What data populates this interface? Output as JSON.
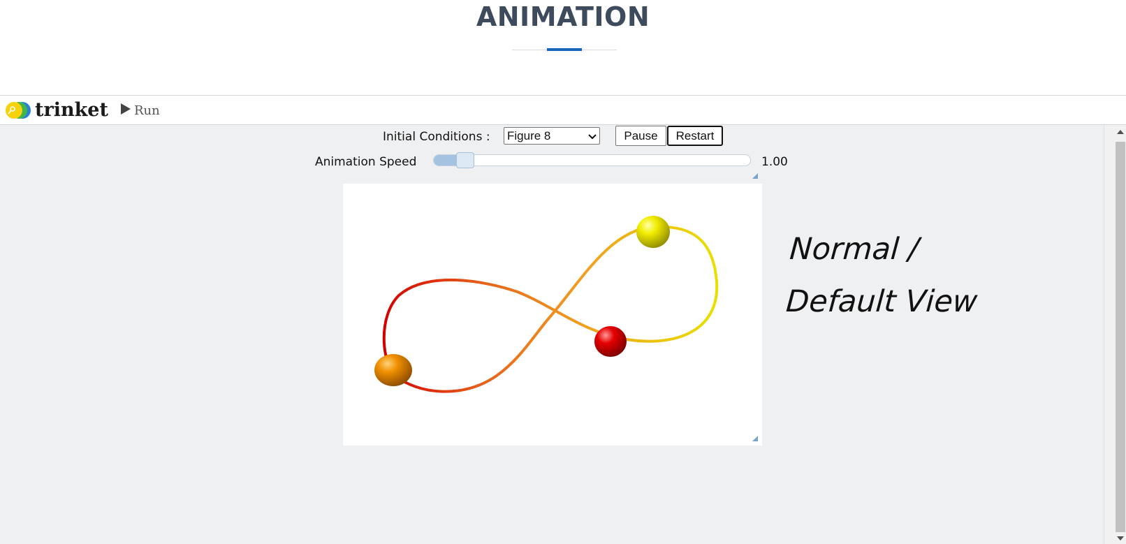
{
  "page": {
    "title": "ANIMATION"
  },
  "trinket": {
    "brand": "trinket",
    "run_label": "Run"
  },
  "controls": {
    "initial_conditions_label": "Initial Conditions :",
    "initial_conditions_value": "Figure 8",
    "pause_label": "Pause",
    "restart_label": "Restart",
    "speed_label": "Animation Speed",
    "speed_value": "1.00",
    "speed_slider_fraction": 0.1
  },
  "scene": {
    "orbit_type": "figure-8",
    "bodies": [
      {
        "color": "#f2ed00",
        "name": "yellow-body"
      },
      {
        "color": "#e60000",
        "name": "red-body"
      },
      {
        "color": "#f09000",
        "name": "orange-body"
      }
    ]
  },
  "annotation": {
    "line1": "Normal /",
    "line2": "Default View"
  },
  "colors": {
    "title": "#3d4b5c",
    "accent": "#1565b8",
    "workspace_bg": "#eff0f2"
  }
}
